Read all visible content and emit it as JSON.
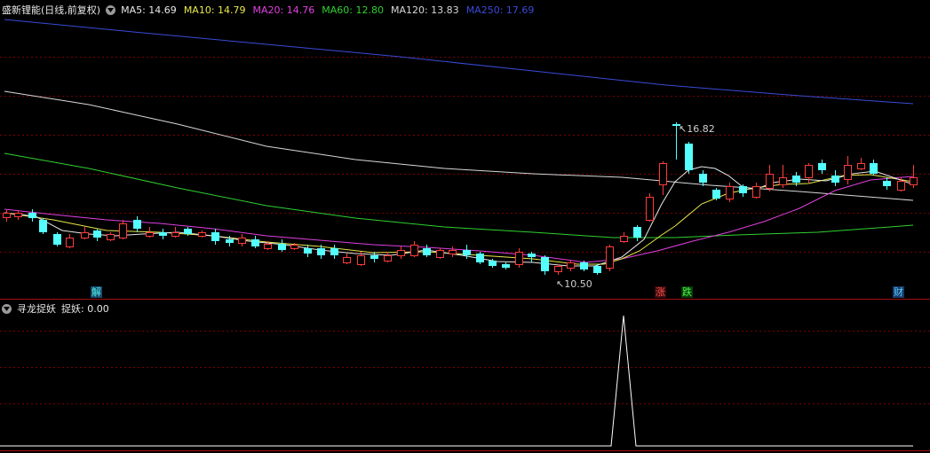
{
  "header": {
    "title": "盛新锂能(日线,前复权)",
    "dropdown_icon": "chevron-down-icon",
    "mas": [
      {
        "label": "MA5: 14.69",
        "color": "#e8e8e8"
      },
      {
        "label": "MA10: 14.79",
        "color": "#e8e84a"
      },
      {
        "label": "MA20: 14.76",
        "color": "#e040e0"
      },
      {
        "label": "MA60: 12.80",
        "color": "#30d030"
      },
      {
        "label": "MA120: 13.83",
        "color": "#d8d8d8"
      },
      {
        "label": "MA250: 17.69",
        "color": "#3a4bd8"
      }
    ]
  },
  "annotations": {
    "high": "16.82",
    "low": "10.50"
  },
  "markers": [
    {
      "text": "解",
      "fg": "#50f0f0",
      "bg": "#1a4a6a"
    },
    {
      "text": "涨",
      "fg": "#ff5050",
      "bg": "#3a0a0a"
    },
    {
      "text": "跌",
      "fg": "#40ff40",
      "bg": "#0a3a0a"
    },
    {
      "text": "财",
      "fg": "#50d0ff",
      "bg": "#1a3a6a"
    }
  ],
  "indicator": {
    "title": "寻龙捉妖",
    "value_label": "捉妖: 0.00"
  },
  "colors": {
    "up": "#ff3b3b",
    "down": "#54ffff",
    "grid": "#7a0000",
    "divider": "#a01010"
  },
  "chart_data": {
    "type": "candlestick",
    "ma_series": [
      {
        "name": "MA5",
        "values": [
          14.69
        ]
      },
      {
        "name": "MA10",
        "values": [
          14.79
        ]
      },
      {
        "name": "MA20",
        "values": [
          14.76
        ]
      },
      {
        "name": "MA60",
        "values": [
          12.8
        ]
      },
      {
        "name": "MA120",
        "values": [
          13.83
        ]
      },
      {
        "name": "MA250",
        "values": [
          17.69
        ]
      }
    ],
    "price_high": 16.82,
    "price_low": 10.5,
    "indicator_value": 0.0
  }
}
